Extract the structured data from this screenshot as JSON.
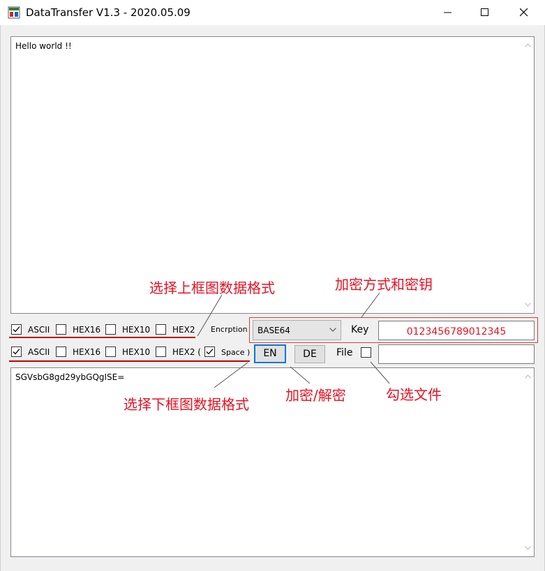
{
  "window": {
    "title": "DataTransfer V1.3 - 2020.05.09",
    "controls": [
      "minimize-icon",
      "maximize-icon",
      "close-icon"
    ]
  },
  "top_textbox": {
    "value": "Hello world !!"
  },
  "row1": {
    "checkboxes": [
      {
        "label": "ASCII",
        "checked": true
      },
      {
        "label": "HEX16",
        "checked": false
      },
      {
        "label": "HEX10",
        "checked": false
      },
      {
        "label": "HEX2",
        "checked": false
      }
    ],
    "encryption_label": "Encrption",
    "encryption_selected": "BASE64",
    "key_label": "Key",
    "key_value": "0123456789012345"
  },
  "row2": {
    "checkboxes": [
      {
        "label": "ASCII",
        "checked": true
      },
      {
        "label": "HEX16",
        "checked": false
      },
      {
        "label": "HEX10",
        "checked": false
      },
      {
        "label": "HEX2 (",
        "checked": false
      },
      {
        "label": "Space )",
        "checked": true
      }
    ],
    "en_button": "EN",
    "de_button": "DE",
    "file_label": "File",
    "file_checked": false,
    "file_value": ""
  },
  "bottom_textbox": {
    "value": "SGVsbG8gd29ybGQgISE="
  },
  "annotations": {
    "upper_format": "选择上框图数据格式",
    "encrypt_method": "加密方式和密钥",
    "lower_format": "选择下框图数据格式",
    "en_de": "加密/解密",
    "select_file": "勾选文件"
  },
  "colors": {
    "annotation": "#e81123",
    "focus": "#0078d7",
    "client_bg": "#f0f0f0"
  }
}
